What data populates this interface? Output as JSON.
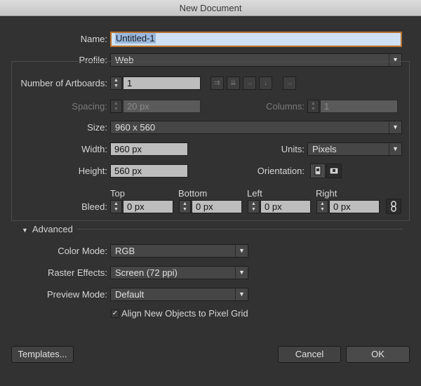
{
  "window": {
    "title": "New Document"
  },
  "name": {
    "label": "Name:",
    "value": "Untitled-1"
  },
  "profile": {
    "label": "Profile:",
    "value": "Web"
  },
  "artboards": {
    "label": "Number of Artboards:",
    "value": "1"
  },
  "spacing": {
    "label": "Spacing:",
    "value": "20 px"
  },
  "columns": {
    "label": "Columns:",
    "value": "1"
  },
  "size": {
    "label": "Size:",
    "value": "960 x 560"
  },
  "width": {
    "label": "Width:",
    "value": "960 px"
  },
  "units": {
    "label": "Units:",
    "value": "Pixels"
  },
  "height": {
    "label": "Height:",
    "value": "560 px"
  },
  "orientation": {
    "label": "Orientation:"
  },
  "bleed": {
    "label": "Bleed:",
    "top": {
      "label": "Top",
      "value": "0 px"
    },
    "bottom": {
      "label": "Bottom",
      "value": "0 px"
    },
    "left": {
      "label": "Left",
      "value": "0 px"
    },
    "right": {
      "label": "Right",
      "value": "0 px"
    }
  },
  "advanced": {
    "label": "Advanced"
  },
  "color_mode": {
    "label": "Color Mode:",
    "value": "RGB"
  },
  "raster_effects": {
    "label": "Raster Effects:",
    "value": "Screen (72 ppi)"
  },
  "preview_mode": {
    "label": "Preview Mode:",
    "value": "Default"
  },
  "align_pixel_grid": {
    "label": "Align New Objects to Pixel Grid",
    "checked": true
  },
  "buttons": {
    "templates": "Templates...",
    "cancel": "Cancel",
    "ok": "OK"
  }
}
